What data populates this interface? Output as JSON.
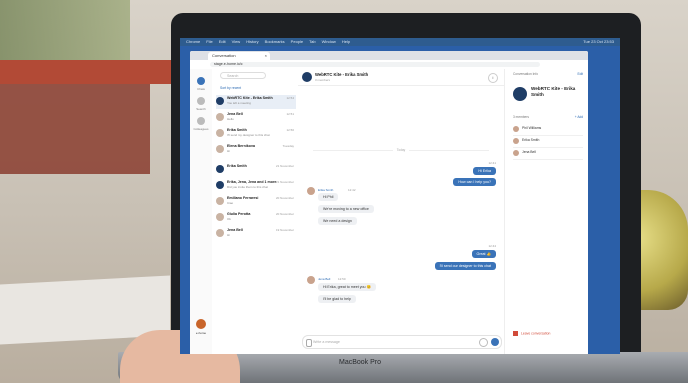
{
  "menubar": {
    "items": [
      "Chrome",
      "File",
      "Edit",
      "View",
      "History",
      "Bookmarks",
      "People",
      "Tab",
      "Window",
      "Help"
    ],
    "status": "Tue 23 Oct  23:53"
  },
  "browser": {
    "tab_title": "Conversation",
    "tab_close": "×",
    "url": "stage.e-home.io/c"
  },
  "rail": {
    "items": [
      {
        "label": "Chats"
      },
      {
        "label": "Search"
      },
      {
        "label": "Colleagues"
      }
    ],
    "brand": "e-home"
  },
  "conversations": {
    "search_placeholder": "Search",
    "sort_label": "Sort by recent",
    "items": [
      {
        "name": "WebRTC Kite - Erika Smith",
        "preview": "You left a meeting",
        "time": "12:54"
      },
      {
        "name": "Jena Bell",
        "preview": "Hello",
        "time": "12:51"
      },
      {
        "name": "Erika Smith",
        "preview": "I'll send my designer to this chat",
        "time": "12:50"
      },
      {
        "name": "Elena Bernikova",
        "preview": "Hi",
        "time": "Tuesday"
      },
      {
        "name": "Erika Smith",
        "preview": "",
        "time": "21 November"
      },
      {
        "name": "Erika, Jena, Jena and 1 more",
        "preview": "Did you invite them to this chat",
        "time": "21 November"
      },
      {
        "name": "Emiliano Ferraresi",
        "preview": "Ciao",
        "time": "20 November"
      },
      {
        "name": "Giulia Perotta",
        "preview": "Ok",
        "time": "20 November"
      },
      {
        "name": "Jena Bell",
        "preview": "Hi",
        "time": "19 November"
      }
    ]
  },
  "chat": {
    "title": "WebRTC Kite - Erika Smith",
    "subtitle": "3 members",
    "info_icon": "i",
    "day_separator": "Today",
    "messages": [
      {
        "direction": "out",
        "text": "Hi Erika",
        "time": "12:41"
      },
      {
        "direction": "out",
        "text": "How can I help you?"
      },
      {
        "direction": "in",
        "sender": "Erika Smith",
        "time": "12:42",
        "text": "Hi Phil"
      },
      {
        "direction": "in",
        "text": "We're moving to a new office"
      },
      {
        "direction": "in",
        "text": "We need a design"
      },
      {
        "direction": "out",
        "text": "Great 👍",
        "time": "12:44"
      },
      {
        "direction": "out",
        "text": "I'll send our designer to this chat"
      },
      {
        "direction": "in",
        "sender": "Jena Bell",
        "time": "12:50",
        "text": "Hi Erika, great to meet you 😊"
      },
      {
        "direction": "in",
        "text": "I'll be glad to help"
      }
    ],
    "composer_placeholder": "Write a message"
  },
  "info_panel": {
    "header": "Conversation Info",
    "edit": "Edit",
    "group_name": "WebRTC Kite - Erika Smith",
    "members_count": "3 members",
    "add": "+ Add",
    "members": [
      "Phil Williams",
      "Erika Smith",
      "Jena Bell"
    ],
    "leave": "Leave conversation"
  },
  "device": {
    "label": "MacBook Pro"
  }
}
